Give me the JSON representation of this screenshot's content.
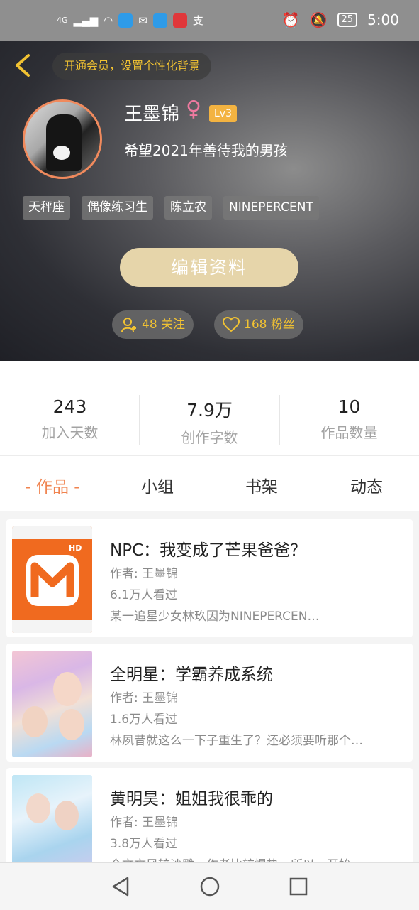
{
  "status_bar": {
    "network": "4G",
    "battery": "25",
    "time": "5:00"
  },
  "header": {
    "member_prompt": "开通会员，设置个性化背景",
    "username": "王墨锦",
    "gender_symbol": "♀",
    "level": "Lv3",
    "signature": "希望2021年善待我的男孩",
    "tags": [
      "天秤座",
      "偶像练习生",
      "陈立农",
      "NINEPERCENT"
    ],
    "edit_button": "编辑资料",
    "following": "48 关注",
    "fans": "168 粉丝"
  },
  "stats": [
    {
      "value": "243",
      "label": "加入天数"
    },
    {
      "value": "7.9万",
      "label": "创作字数"
    },
    {
      "value": "10",
      "label": "作品数量"
    }
  ],
  "tabs": [
    {
      "label": "- 作品 -",
      "active": true
    },
    {
      "label": "小组",
      "active": false
    },
    {
      "label": "书架",
      "active": false
    },
    {
      "label": "动态",
      "active": false
    }
  ],
  "works": [
    {
      "title": "NPC：我变成了芒果爸爸？",
      "author": "作者: 王墨锦",
      "views": "6.1万人看过",
      "desc": "某一追星少女林玖因为NINEPERCEN…",
      "cover_badge": "HD"
    },
    {
      "title": "全明星：学霸养成系统",
      "author": "作者: 王墨锦",
      "views": "1.6万人看过",
      "desc": "林夙昔就这么一下子重生了？还必须要听那个…"
    },
    {
      "title": "黄明昊：姐姐我很乖的",
      "author": "作者: 王墨锦",
      "views": "3.8万人看过",
      "desc": "全文文风较沙雕，作者比较慢热，所以一开始…"
    }
  ],
  "colors": {
    "accent": "#f0834f",
    "gold": "#f1c232",
    "edit_button": "#e6d5aa"
  }
}
